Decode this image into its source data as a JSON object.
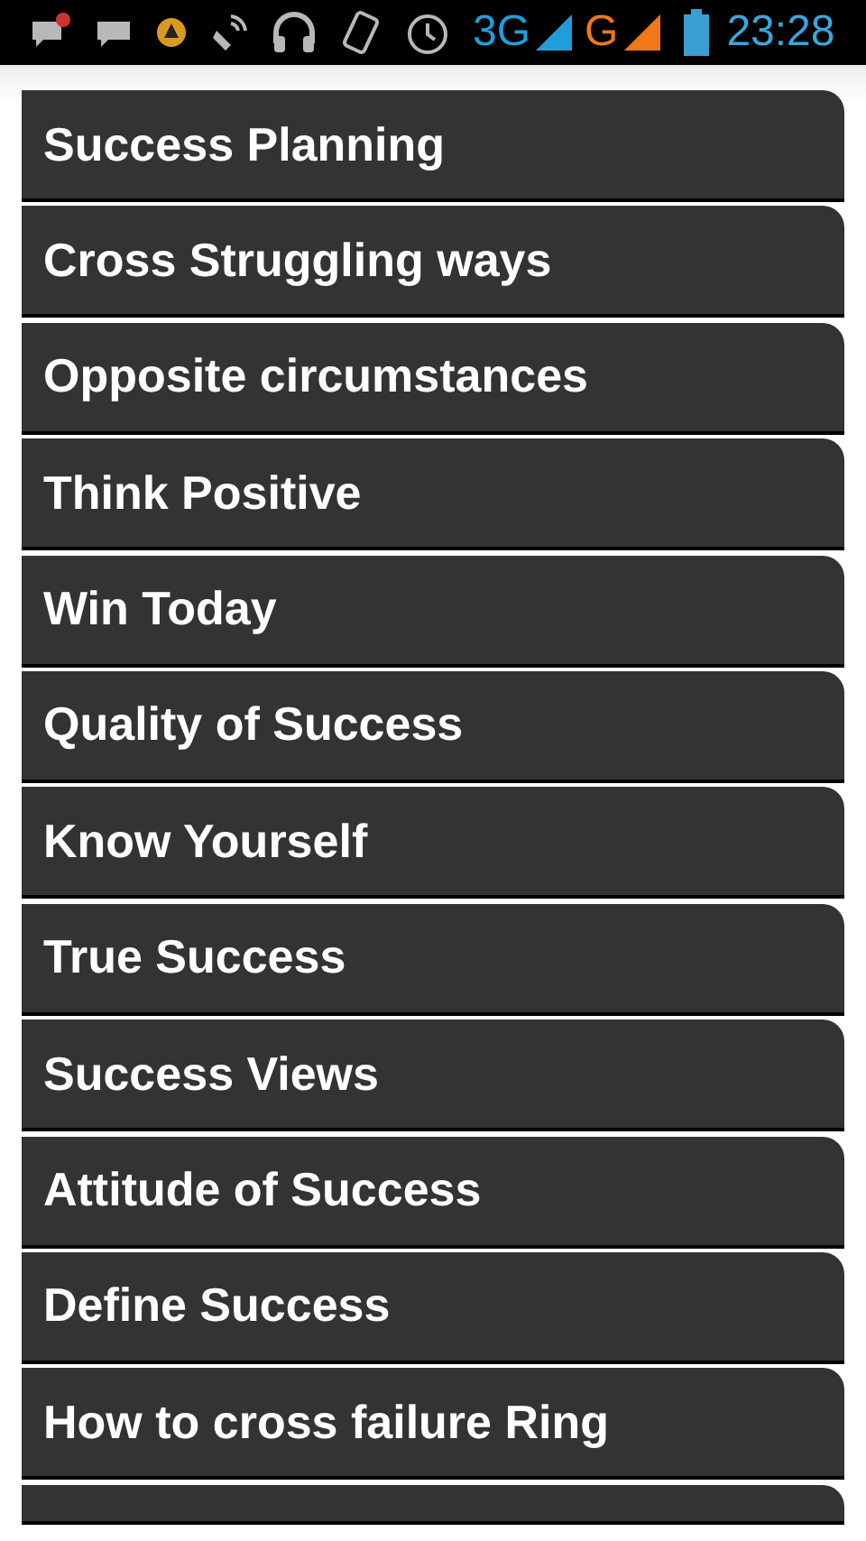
{
  "status_bar": {
    "networks": [
      {
        "label": "3G",
        "color": "#1e9fdc"
      },
      {
        "label": "G",
        "color": "#f07818"
      }
    ],
    "time": "23:28"
  },
  "items": [
    {
      "title": "Success Planning"
    },
    {
      "title": "Cross Struggling ways"
    },
    {
      "title": "Opposite circumstances"
    },
    {
      "title": "Think Positive"
    },
    {
      "title": "Win Today"
    },
    {
      "title": "Quality of Success"
    },
    {
      "title": "Know Yourself"
    },
    {
      "title": "True Success"
    },
    {
      "title": "Success Views"
    },
    {
      "title": "Attitude of Success"
    },
    {
      "title": "Define Success"
    },
    {
      "title": "How to cross failure Ring"
    },
    {
      "kind": "cut-off"
    }
  ]
}
